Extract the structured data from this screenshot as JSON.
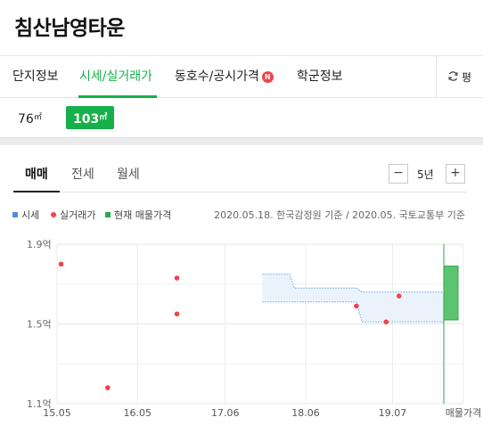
{
  "header": {
    "title": "침산남영타운"
  },
  "tabs": [
    {
      "label": "단지정보"
    },
    {
      "label": "시세/실거래가"
    },
    {
      "label": "동호수/공시가격",
      "badge": "N"
    },
    {
      "label": "학군정보"
    }
  ],
  "side_button": {
    "label": "평"
  },
  "areas": [
    {
      "value": "76",
      "unit": "㎡"
    },
    {
      "value": "103",
      "unit": "㎡"
    }
  ],
  "subtabs": [
    {
      "label": "매매"
    },
    {
      "label": "전세"
    },
    {
      "label": "월세"
    }
  ],
  "period": {
    "minus": "−",
    "value": "5년",
    "plus": "+"
  },
  "legend": [
    {
      "label": "시세",
      "color": "#4a90e2"
    },
    {
      "label": "실거래가",
      "color": "#f0434b"
    },
    {
      "label": "현재 매물가격",
      "color": "#2aa84a"
    }
  ],
  "source_note": "2020.05.18. 한국감정원 기준 / 2020.05. 국토교통부 기준",
  "colors": {
    "accent": "#16b04a",
    "badge": "#f0434b"
  },
  "chart_data": {
    "type": "scatter",
    "y_ticks": [
      "1.9억",
      "1.5억",
      "1.1억"
    ],
    "y_tick_values": [
      1.9,
      1.5,
      1.1
    ],
    "ylim": [
      1.1,
      1.9
    ],
    "x_ticks": [
      "15.05",
      "16.05",
      "17.06",
      "18.06",
      "19.07",
      "매물가격"
    ],
    "x_tick_values": [
      2015.33,
      2016.33,
      2017.42,
      2018.42,
      2019.5
    ],
    "xlim": [
      2015.33,
      2020.38
    ],
    "grid": true,
    "transactions": [
      {
        "x": 2015.38,
        "y": 1.8
      },
      {
        "x": 2015.96,
        "y": 1.18
      },
      {
        "x": 2016.82,
        "y": 1.73
      },
      {
        "x": 2016.82,
        "y": 1.55
      },
      {
        "x": 2019.05,
        "y": 1.59
      },
      {
        "x": 2019.42,
        "y": 1.51
      },
      {
        "x": 2019.58,
        "y": 1.64
      }
    ],
    "market_price_band": [
      {
        "x": 2017.88,
        "upper": 1.75,
        "lower": 1.61
      },
      {
        "x": 2018.22,
        "upper": 1.75,
        "lower": 1.61
      },
      {
        "x": 2018.28,
        "upper": 1.68,
        "lower": 1.61
      },
      {
        "x": 2019.05,
        "upper": 1.68,
        "lower": 1.61
      },
      {
        "x": 2019.12,
        "upper": 1.66,
        "lower": 1.51
      },
      {
        "x": 2020.15,
        "upper": 1.66,
        "lower": 1.51
      }
    ],
    "current_listing": {
      "low": 1.52,
      "high": 1.79
    }
  }
}
